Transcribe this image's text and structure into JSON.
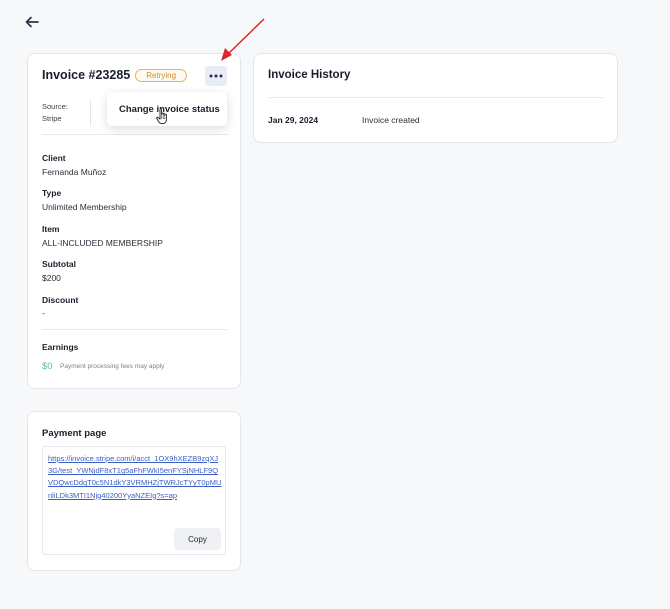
{
  "invoice": {
    "title": "Invoice #23285",
    "status": "Retrying",
    "source_label": "Source:",
    "source_value": "Stripe",
    "fields": [
      {
        "label": "Client",
        "value": "Fernanda Muñoz"
      },
      {
        "label": "Type",
        "value": "Unlimited Membership"
      },
      {
        "label": "Item",
        "value": "ALL-INCLUDED MEMBERSHIP"
      },
      {
        "label": "Subtotal",
        "value": "$200"
      },
      {
        "label": "Discount",
        "value": "-"
      }
    ],
    "earnings_label": "Earnings",
    "earnings_value": "$0",
    "earnings_note": "Payment processing fees may apply"
  },
  "menu": {
    "change_status": "Change invoice status"
  },
  "history": {
    "title": "Invoice History",
    "entries": [
      {
        "date": "Jan 29, 2024",
        "event": "Invoice created"
      }
    ]
  },
  "payment": {
    "title": "Payment page",
    "url": "https://invoice.stripe.com/i/acct_1OX9hXEZB9zqXJ3G/test_YWNjdF8xT1g5aFhFWkI5enFYSjNHLF9QVDQwcDdqT0c5N1dkY3VRMHZjTWRJcTYyT0pMUnliLDk3MTI1Njg40200YyaNZEIg?s=ap",
    "copy_label": "Copy"
  },
  "colors": {
    "status": "#c8902a",
    "earnings": "#5cc18a",
    "link": "#3b5fc4",
    "annotation_arrow": "#d9272e"
  }
}
